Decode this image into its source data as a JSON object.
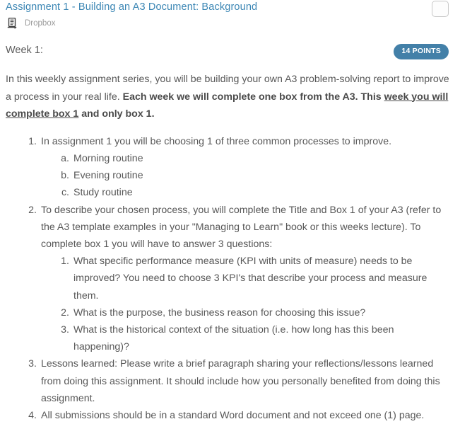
{
  "header": {
    "title": "Assignment 1 - Building an A3 Document: Background",
    "submission_type": "Dropbox",
    "doc_icon": "document-icon",
    "checkbox_checked": false,
    "title_color": "#3b86b4"
  },
  "week": {
    "label": "Week 1:",
    "points_badge": "14 POINTS",
    "badge_color": "#4380a8",
    "badge_text_color": "#ffffff"
  },
  "intro": {
    "part1": "In this weekly assignment series, you will be building your own A3 problem-solving report to improve a process in your real life.  ",
    "bold1": "Each week we will complete one box from the A3. This ",
    "bold_underline": "week you will complete box 1",
    "bold2": " and only box 1."
  },
  "instructions": [
    {
      "marker": "1.",
      "text": "In assignment 1 you will be choosing 1 of three common processes to improve.",
      "sub": [
        {
          "marker": "a.",
          "text": "Morning routine"
        },
        {
          "marker": "b.",
          "text": "Evening routine"
        },
        {
          "marker": "c.",
          "text": "Study routine"
        }
      ]
    },
    {
      "marker": "2.",
      "text": "To describe your chosen process, you will complete the Title and Box 1 of your A3 (refer to the A3 template examples in your \"Managing to Learn\" book or this weeks lecture).  To complete box 1 you will have to answer 3 questions:",
      "sub": [
        {
          "marker": "1.",
          "text": "What specific performance measure (KPI with units of measure) needs to be improved? You need to choose 3 KPI's that describe your process and measure them."
        },
        {
          "marker": "2.",
          "text": " What is the purpose, the business reason for choosing this issue?"
        },
        {
          "marker": "3.",
          "text": "What is the historical context of the situation (i.e. how long has this been happening)?"
        }
      ]
    },
    {
      "marker": "3.",
      "text": "Lessons learned: Please write a brief paragraph sharing your reflections/lessons learned from doing this assignment.  It should include how you personally benefited from doing this assignment.",
      "sub": []
    },
    {
      "marker": "4.",
      "text": "All submissions should be in a standard Word document and not exceed one (1) page.",
      "sub": []
    }
  ]
}
